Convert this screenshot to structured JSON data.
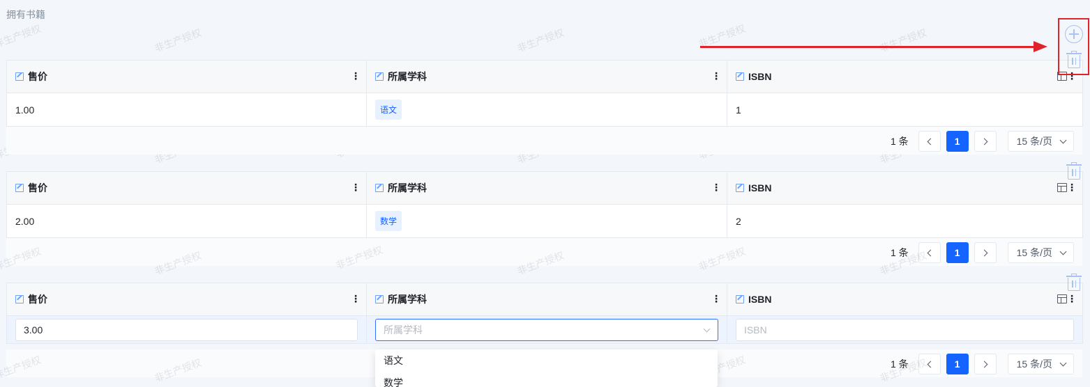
{
  "section_title": "拥有书籍",
  "watermark_text": "非生产授权",
  "columns": {
    "price": "售价",
    "subject": "所属学科",
    "isbn": "ISBN"
  },
  "rows": [
    {
      "price": "1.00",
      "subject": "语文",
      "isbn": "1"
    },
    {
      "price": "2.00",
      "subject": "数学",
      "isbn": "2"
    }
  ],
  "edit_row": {
    "price_value": "3.00",
    "subject_placeholder": "所属学科",
    "isbn_placeholder": "ISBN"
  },
  "pagination": {
    "total_label": "1 条",
    "current_page": "1",
    "page_size_label": "15 条/页"
  },
  "dropdown_options": [
    "语文",
    "数学"
  ],
  "icons": {
    "add": "plus-circle-icon",
    "delete": "trash-icon",
    "column_menu": "more-vertical-icon",
    "table_settings": "table-settings-icon",
    "edit_column": "edit-icon"
  },
  "colors": {
    "primary": "#1664ff",
    "tag_bg": "#e8f1ff",
    "annotation": "#e0232b"
  }
}
